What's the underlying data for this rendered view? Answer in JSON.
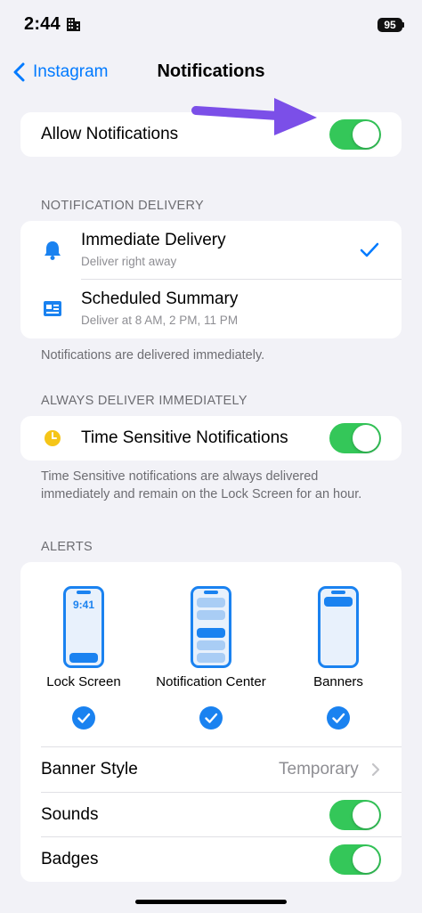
{
  "status_bar": {
    "time": "2:44",
    "battery": "95"
  },
  "nav": {
    "back_label": "Instagram",
    "title": "Notifications"
  },
  "allow": {
    "label": "Allow Notifications",
    "on": true
  },
  "delivery": {
    "header": "NOTIFICATION DELIVERY",
    "items": [
      {
        "title": "Immediate Delivery",
        "subtitle": "Deliver right away",
        "icon": "bell-icon",
        "selected": true
      },
      {
        "title": "Scheduled Summary",
        "subtitle": "Deliver at 8 AM, 2 PM, 11 PM",
        "icon": "newspaper-icon",
        "selected": false
      }
    ],
    "footer": "Notifications are delivered immediately."
  },
  "always": {
    "header": "ALWAYS DELIVER IMMEDIATELY",
    "label": "Time Sensitive Notifications",
    "icon": "clock-icon",
    "on": true,
    "footer": "Time Sensitive notifications are always delivered immediately and remain on the Lock Screen for an hour."
  },
  "alerts": {
    "header": "ALERTS",
    "options": [
      {
        "label": "Lock Screen",
        "preview_time": "9:41",
        "checked": true
      },
      {
        "label": "Notification Center",
        "checked": true
      },
      {
        "label": "Banners",
        "checked": true
      }
    ],
    "banner_style": {
      "label": "Banner Style",
      "value": "Temporary"
    },
    "sounds": {
      "label": "Sounds",
      "on": true
    },
    "badges": {
      "label": "Badges",
      "on": true
    }
  },
  "colors": {
    "accent": "#007aff",
    "toggle_on": "#34c759",
    "alert_blue": "#1a82f0",
    "annotation_arrow": "#7b4fe8",
    "clock_yellow": "#f5c518"
  }
}
